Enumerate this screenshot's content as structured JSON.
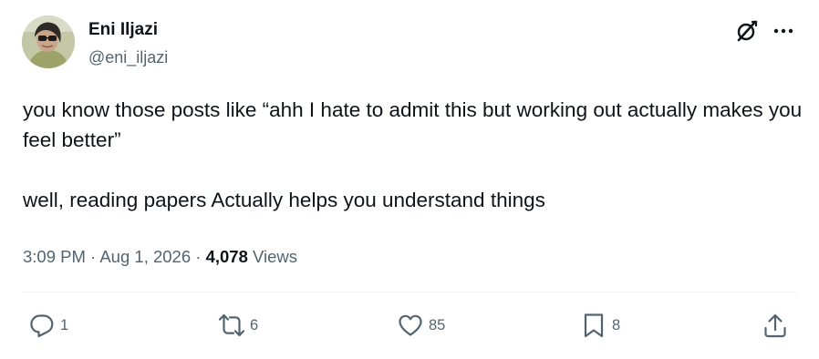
{
  "author": {
    "display_name": "Eni Iljazi",
    "handle": "@eni_iljazi"
  },
  "tweet": {
    "text_line1": "you know those posts like “ahh I hate to admit this but working out actually makes you feel better”",
    "text_line2": "well, reading papers Actually helps you understand things"
  },
  "meta": {
    "time": "3:09 PM",
    "separator": "·",
    "date": "Aug 1, 2026",
    "views_count": "4,078",
    "views_label": "Views"
  },
  "actions": {
    "replies": "1",
    "reposts": "6",
    "likes": "85",
    "bookmarks": "8"
  },
  "icons": {
    "header": [
      "grok-icon",
      "more-options-icon"
    ],
    "actions": [
      "reply-icon",
      "repost-icon",
      "like-icon",
      "bookmark-icon",
      "share-icon"
    ]
  },
  "colors": {
    "text_primary": "#0f1419",
    "text_secondary": "#536471",
    "divider": "#eff3f4"
  }
}
